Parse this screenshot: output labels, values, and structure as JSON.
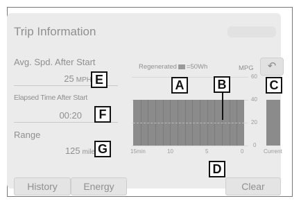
{
  "screen": {
    "title": "Trip Information"
  },
  "left_panel": {
    "avg_speed": {
      "label": "Avg. Spd. After Start",
      "value": "25",
      "unit": "MPH"
    },
    "elapsed_time": {
      "label": "Elapsed Time After Start",
      "value": "00:20"
    },
    "range": {
      "label": "Range",
      "value": "125",
      "unit": "miles"
    }
  },
  "graph": {
    "regenerated_label": "Regenerated",
    "regenerated_value": "=50Wh",
    "unit_label": "MPG",
    "y_ticks": [
      "60",
      "40",
      "20",
      "0"
    ],
    "x_ticks": [
      "15min",
      "10",
      "5",
      "0",
      "Current"
    ],
    "fuel_economy_level_mpg": 40,
    "current_level_mpg": 40
  },
  "buttons": {
    "history": "History",
    "energy": "Energy",
    "clear": "Clear"
  },
  "callouts": {
    "a": "A",
    "b": "B",
    "c": "C",
    "d": "D",
    "e": "E",
    "f": "F",
    "g": "G"
  },
  "colors": {
    "bar": "#8b8b8b",
    "screen_bg": "#ebebeb",
    "text": "#8f8f8f"
  }
}
